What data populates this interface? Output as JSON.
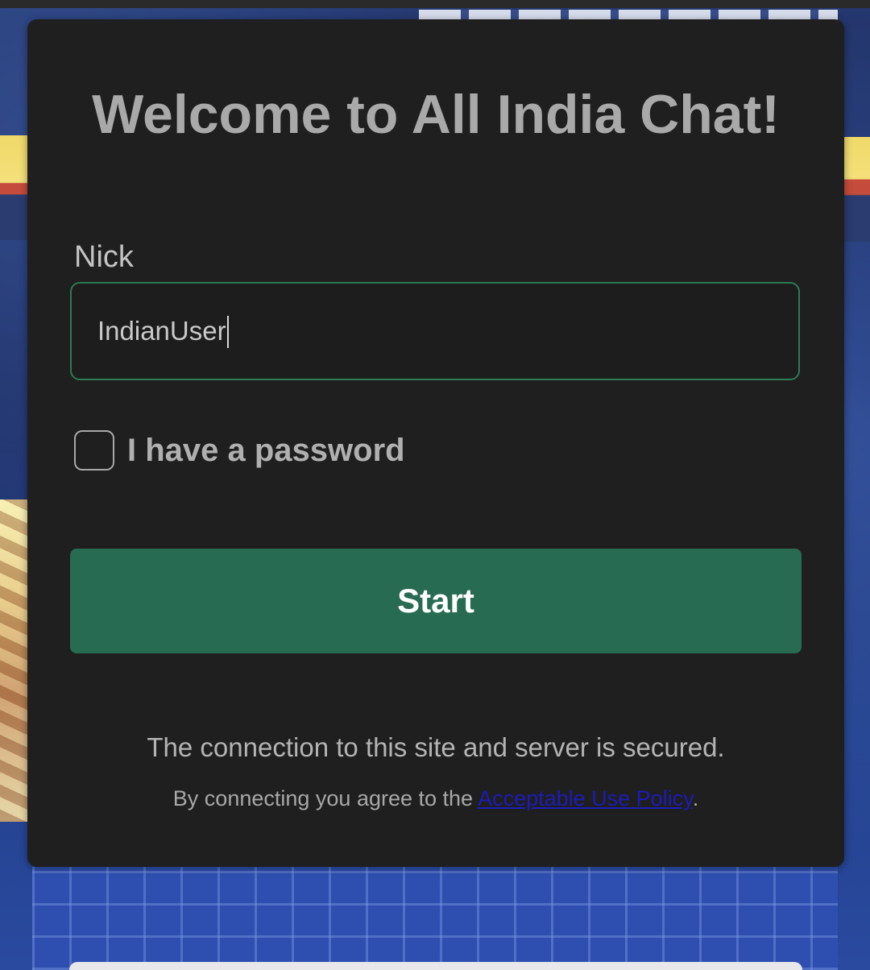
{
  "login": {
    "title": "Welcome to All India Chat!",
    "nick_label": "Nick",
    "nick_value": "IndianUser",
    "password_checkbox_label": "I have a password",
    "password_checked": false,
    "start_button": "Start",
    "secure_notice": "The connection to this site and server is secured.",
    "agreement_prefix": "By connecting you agree to the ",
    "policy_link": "Acceptable Use Policy",
    "agreement_suffix": "."
  },
  "colors": {
    "accent": "#276b52",
    "input_border": "#2d7a55",
    "card_background": "#1f1f1f",
    "link": "#1d1cb8"
  }
}
